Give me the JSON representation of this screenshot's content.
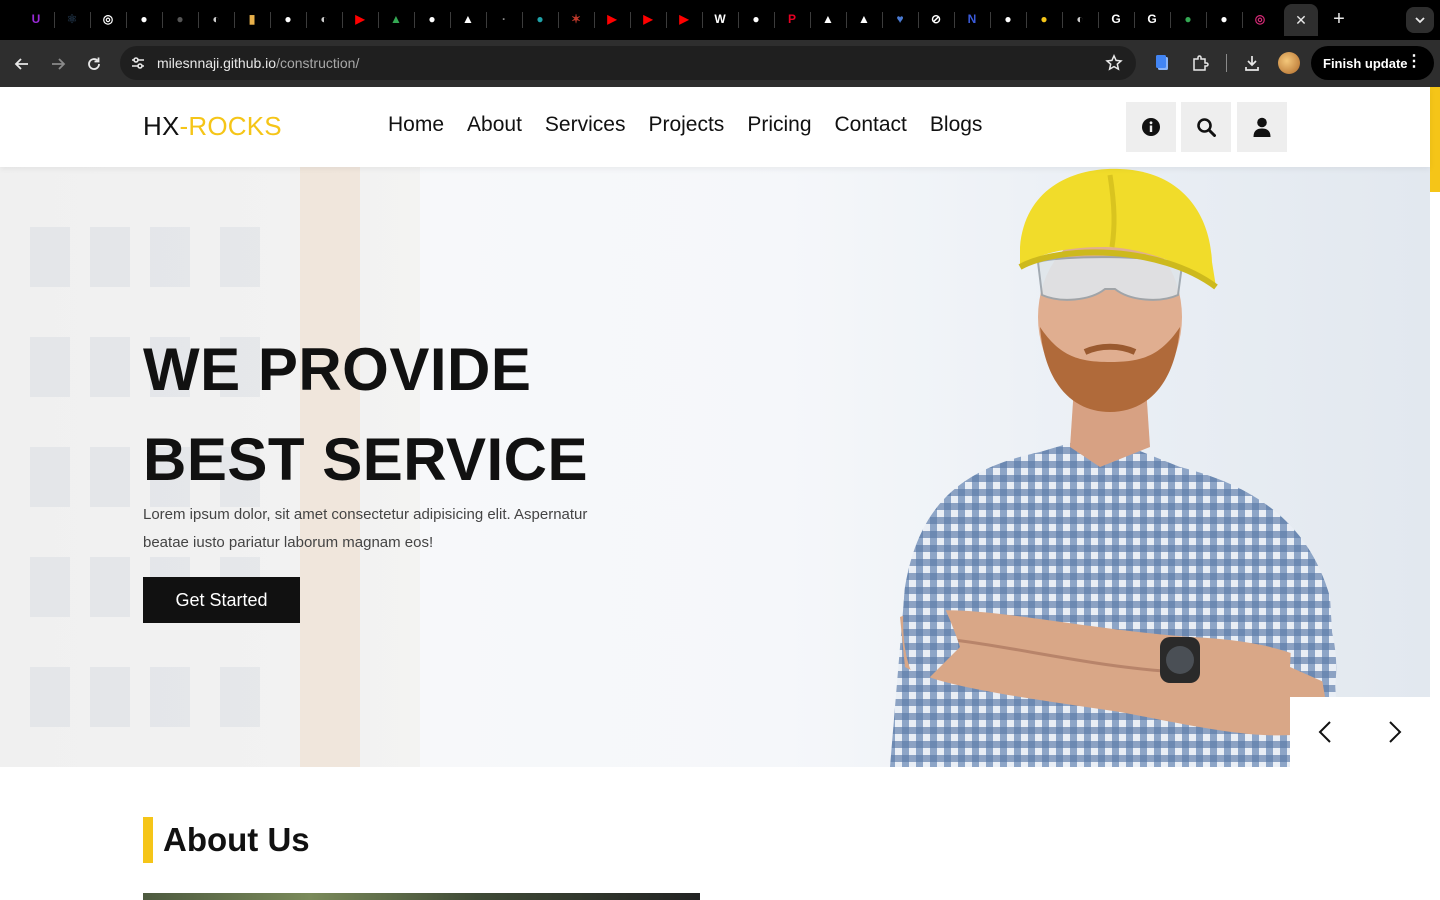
{
  "browser": {
    "tab_favicons": [
      {
        "icon": "purple-circle-icon",
        "color": "#9b2bd8",
        "glyph": "U"
      },
      {
        "icon": "react-icon",
        "color": "#1a2a3a",
        "glyph": "⚛"
      },
      {
        "icon": "openai-icon",
        "color": "#ffffff",
        "glyph": "◎"
      },
      {
        "icon": "github-icon",
        "color": "#ffffff",
        "glyph": "●"
      },
      {
        "icon": "github-icon",
        "color": "#555555",
        "glyph": "●"
      },
      {
        "icon": "globe-icon",
        "color": "#cfcfcf",
        "glyph": "◐"
      },
      {
        "icon": "bottle-icon",
        "color": "#e8b04a",
        "glyph": "▮"
      },
      {
        "icon": "github-icon",
        "color": "#ffffff",
        "glyph": "●"
      },
      {
        "icon": "globe-icon",
        "color": "#cfcfcf",
        "glyph": "◐"
      },
      {
        "icon": "youtube-icon",
        "color": "#ff0000",
        "glyph": "▶"
      },
      {
        "icon": "google-drive-icon",
        "color": "#34a853",
        "glyph": "▲"
      },
      {
        "icon": "github-icon",
        "color": "#ffffff",
        "glyph": "●"
      },
      {
        "icon": "triangle-icon",
        "color": "#ffffff",
        "glyph": "▲"
      },
      {
        "icon": "small-text-icon",
        "color": "#888888",
        "glyph": "·"
      },
      {
        "icon": "teal-circle-icon",
        "color": "#1fa2a8",
        "glyph": "●"
      },
      {
        "icon": "cart-icon",
        "color": "#c0392b",
        "glyph": "✶"
      },
      {
        "icon": "youtube-icon",
        "color": "#ff0000",
        "glyph": "▶"
      },
      {
        "icon": "youtube-icon",
        "color": "#ff0000",
        "glyph": "▶"
      },
      {
        "icon": "youtube-icon",
        "color": "#ff0000",
        "glyph": "▶"
      },
      {
        "icon": "wix-icon",
        "color": "#ffffff",
        "glyph": "W"
      },
      {
        "icon": "github-icon",
        "color": "#ffffff",
        "glyph": "●"
      },
      {
        "icon": "pinterest-icon",
        "color": "#e60023",
        "glyph": "P"
      },
      {
        "icon": "triangle-icon",
        "color": "#ffffff",
        "glyph": "▲"
      },
      {
        "icon": "triangle-icon",
        "color": "#ffffff",
        "glyph": "▲"
      },
      {
        "icon": "heart-icon",
        "color": "#4a7bd4",
        "glyph": "♥"
      },
      {
        "icon": "compass-icon",
        "color": "#ffffff",
        "glyph": "⊘"
      },
      {
        "icon": "n-logo-icon",
        "color": "#3b5bdb",
        "glyph": "N"
      },
      {
        "icon": "github-icon",
        "color": "#ffffff",
        "glyph": "●"
      },
      {
        "icon": "lemon-icon",
        "color": "#f5c518",
        "glyph": "●"
      },
      {
        "icon": "globe-icon",
        "color": "#cfcfcf",
        "glyph": "◐"
      },
      {
        "icon": "google-icon",
        "color": "#ffffff",
        "glyph": "G"
      },
      {
        "icon": "google-icon",
        "color": "#ffffff",
        "glyph": "G"
      },
      {
        "icon": "maps-icon",
        "color": "#34a853",
        "glyph": "●"
      },
      {
        "icon": "github-icon",
        "color": "#ffffff",
        "glyph": "●"
      },
      {
        "icon": "instagram-icon",
        "color": "#d62976",
        "glyph": "◎"
      }
    ],
    "url_host": "milesnnaji.github.io",
    "url_path": "/construction/",
    "finish_update_label": "Finish update"
  },
  "site": {
    "logo_main": "HX",
    "logo_accent": "-ROCKS",
    "accent_color": "#f5c518",
    "nav": [
      "Home",
      "About",
      "Services",
      "Projects",
      "Pricing",
      "Contact",
      "Blogs"
    ],
    "header_icons": [
      "info-icon",
      "search-icon",
      "user-icon"
    ]
  },
  "hero": {
    "title_line1": "WE PROVIDE",
    "title_line2": "BEST SERVICE",
    "text": "Lorem ipsum dolor, sit amet consectetur adipisicing elit. Aspernatur beatae iusto pariatur laborum magnam eos!",
    "cta_label": "Get Started"
  },
  "about": {
    "title": "About Us"
  }
}
